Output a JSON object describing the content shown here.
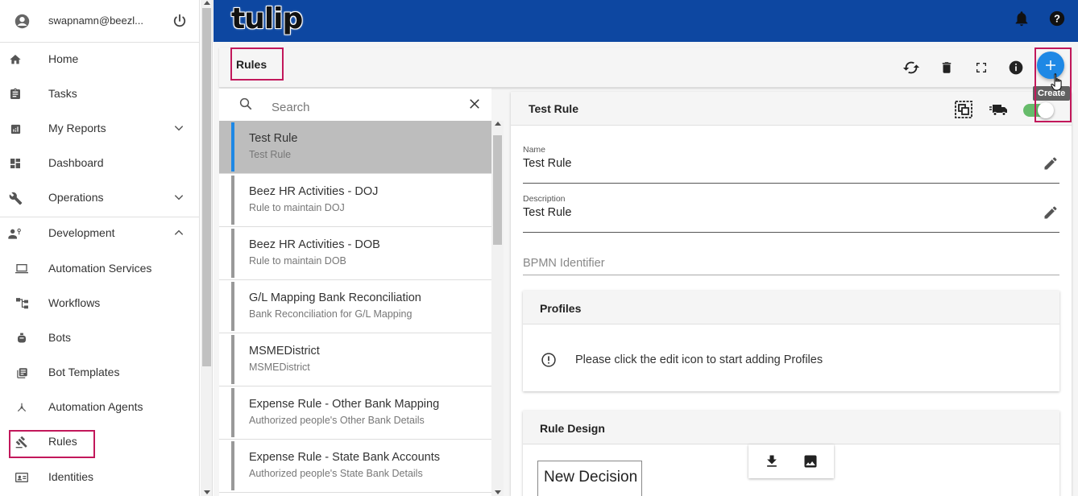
{
  "user": {
    "email": "swapnamn@beezl..."
  },
  "sidebar": {
    "items": [
      {
        "label": "Home",
        "icon": "home-icon"
      },
      {
        "label": "Tasks",
        "icon": "clipboard-icon"
      },
      {
        "label": "My Reports",
        "icon": "report-icon"
      },
      {
        "label": "Dashboard",
        "icon": "dashboard-icon"
      },
      {
        "label": "Operations",
        "icon": "wrench-icon"
      },
      {
        "label": "Development",
        "icon": "developer-icon"
      },
      {
        "label": "Automation Services",
        "icon": "laptop-icon"
      },
      {
        "label": "Workflows",
        "icon": "workflow-icon"
      },
      {
        "label": "Bots",
        "icon": "bot-icon"
      },
      {
        "label": "Bot Templates",
        "icon": "templates-icon"
      },
      {
        "label": "Automation Agents",
        "icon": "agents-icon"
      },
      {
        "label": "Rules",
        "icon": "gavel-icon"
      },
      {
        "label": "Identities",
        "icon": "id-card-icon"
      }
    ]
  },
  "topbar": {
    "brand": "tulip"
  },
  "toolbar": {
    "title": "Rules",
    "create_tooltip": "Create"
  },
  "search": {
    "placeholder": "Search"
  },
  "rules": [
    {
      "name": "Test Rule",
      "description": "Test Rule"
    },
    {
      "name": "Beez HR Activities - DOJ",
      "description": "Rule to maintain DOJ"
    },
    {
      "name": "Beez HR Activities - DOB",
      "description": "Rule to maintain DOB"
    },
    {
      "name": "G/L Mapping Bank Reconciliation",
      "description": "Bank Reconciliation for G/L Mapping"
    },
    {
      "name": "MSMEDistrict",
      "description": "MSMEDistrict"
    },
    {
      "name": "Expense Rule - Other Bank Mapping",
      "description": "Authorized people's Other Bank Details"
    },
    {
      "name": "Expense Rule - State Bank Accounts",
      "description": "Authorized people's State Bank Details"
    }
  ],
  "detail": {
    "title": "Test Rule",
    "name_label": "Name",
    "name_value": "Test Rule",
    "description_label": "Description",
    "description_value": "Test Rule",
    "bpmn_placeholder": "BPMN Identifier",
    "profiles_title": "Profiles",
    "profiles_message": "Please click the edit icon to start adding Profiles",
    "rule_design_title": "Rule Design",
    "decision_label": "New Decision"
  },
  "colors": {
    "topbar": "#0d47a1",
    "accent": "#1e88e5",
    "highlight": "#c2185b",
    "toggle_on": "#66bb6a"
  }
}
